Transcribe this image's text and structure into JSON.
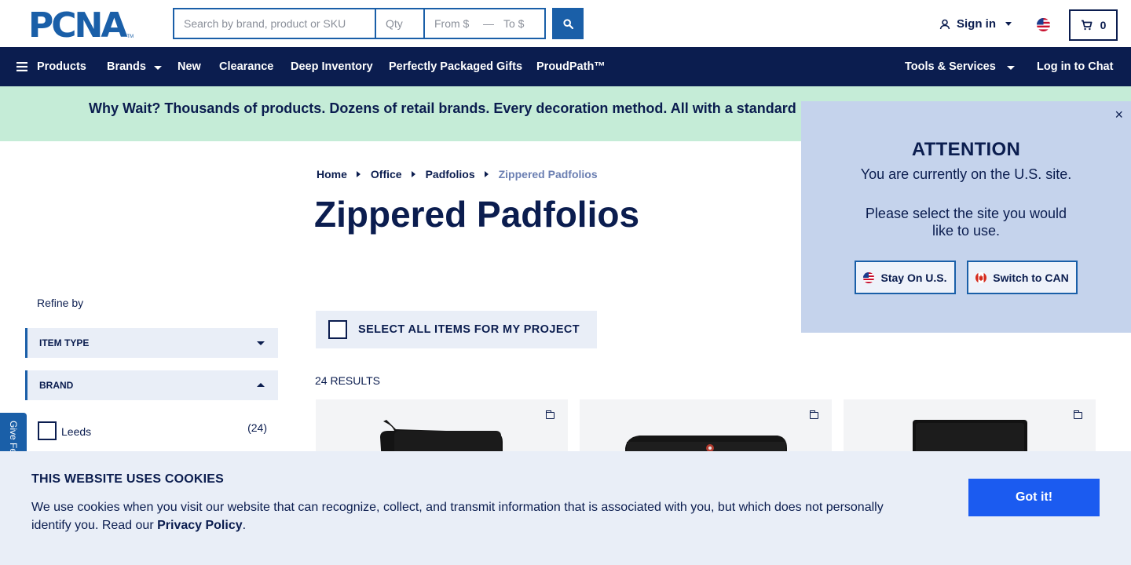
{
  "header": {
    "logo_text": "PCNA",
    "logo_tm": "TM",
    "search_placeholder": "Search by brand, product or SKU",
    "qty_placeholder": "Qty",
    "from_placeholder": "From $",
    "range_dash": "—",
    "to_placeholder": "To $",
    "signin_label": "Sign in",
    "cart_count": "0",
    "site_flag": "us-flag-icon"
  },
  "nav": {
    "products": "Products",
    "brands": "Brands",
    "new": "New",
    "clearance": "Clearance",
    "deep_inventory": "Deep Inventory",
    "gifts": "Perfectly Packaged Gifts",
    "proudpath": "ProudPath™",
    "tools": "Tools & Services",
    "chat": "Log in to Chat"
  },
  "promo": {
    "text": "Why Wait? Thousands of products. Dozens of retail brands. Every decoration method. All with a standard"
  },
  "breadcrumb": {
    "home": "Home",
    "office": "Office",
    "padfolios": "Padfolios",
    "current": "Zippered Padfolios"
  },
  "page": {
    "title": "Zippered Padfolios",
    "select_all": "SELECT ALL ITEMS FOR MY PROJECT",
    "results": "24 RESULTS"
  },
  "filters": {
    "refine_label": "Refine by",
    "facets": [
      {
        "label": "ITEM TYPE",
        "expanded": false
      },
      {
        "label": "BRAND",
        "expanded": true
      }
    ],
    "brand_option": {
      "label": "Leeds",
      "count": "(24)",
      "checked": false
    },
    "feedback_label": "Give Feedback"
  },
  "attention": {
    "close": "×",
    "title": "ATTENTION",
    "line1": "You are currently on the U.S. site.",
    "line2": "Please select the site you would like to use.",
    "stay_label": "Stay On U.S.",
    "switch_label": "Switch to CAN"
  },
  "cookie": {
    "title": "THIS WEBSITE USES COOKIES",
    "text": "We use cookies when you visit our website that can recognize, collect, and transmit information that is associated with you, but which does not personally identify you. Read our ",
    "link": "Privacy Policy",
    "period": ".",
    "button": "Got it!"
  },
  "colors": {
    "navy": "#0b1d4f",
    "brand_blue": "#1a5fa8",
    "promo_green": "#c5ecd7",
    "modal_blue": "#c5d3ec",
    "panel_grey": "#e9eef7",
    "cta_blue": "#1b5bf0"
  }
}
